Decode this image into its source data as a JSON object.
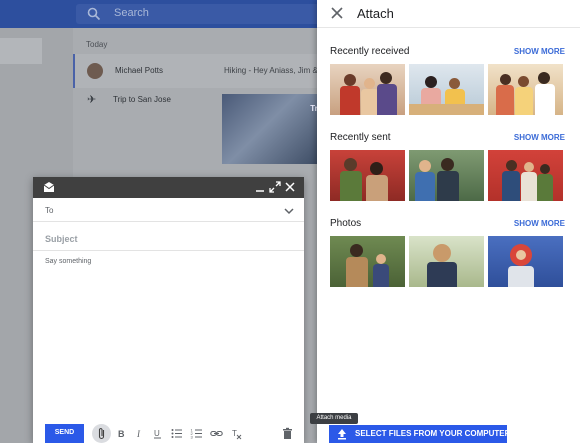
{
  "background": {
    "search_placeholder": "Search",
    "section_today": "Today",
    "rows": [
      {
        "sender": "Michael Potts",
        "snippet": "Hiking - Hey Aniass, Jim & Dusti"
      },
      {
        "sender": "Trip to San Jose",
        "preview_text": "Tri"
      }
    ]
  },
  "attach_panel": {
    "title": "Attach",
    "sections": [
      {
        "title": "Recently received",
        "action": "SHOW MORE"
      },
      {
        "title": "Recently sent",
        "action": "SHOW MORE"
      },
      {
        "title": "Photos",
        "action": "SHOW MORE"
      }
    ],
    "select_files_label": "SELECT FILES FROM YOUR COMPUTER"
  },
  "tooltip": "Attach media",
  "compose": {
    "to_label": "To",
    "subject_placeholder": "Subject",
    "body_placeholder": "Say something",
    "send_label": "SEND",
    "icons": [
      "mail-icon",
      "minimize-icon",
      "expand-icon",
      "close-icon",
      "attach-icon",
      "bold-icon",
      "italic-icon",
      "underline-icon",
      "bulleted-list-icon",
      "numbered-list-icon",
      "link-icon",
      "clear-format-icon",
      "trash-icon"
    ]
  },
  "colors": {
    "accent": "#2b59e8",
    "link": "#3b6bd7",
    "topbar": "#2d4f9e",
    "compose_header": "#404040"
  }
}
